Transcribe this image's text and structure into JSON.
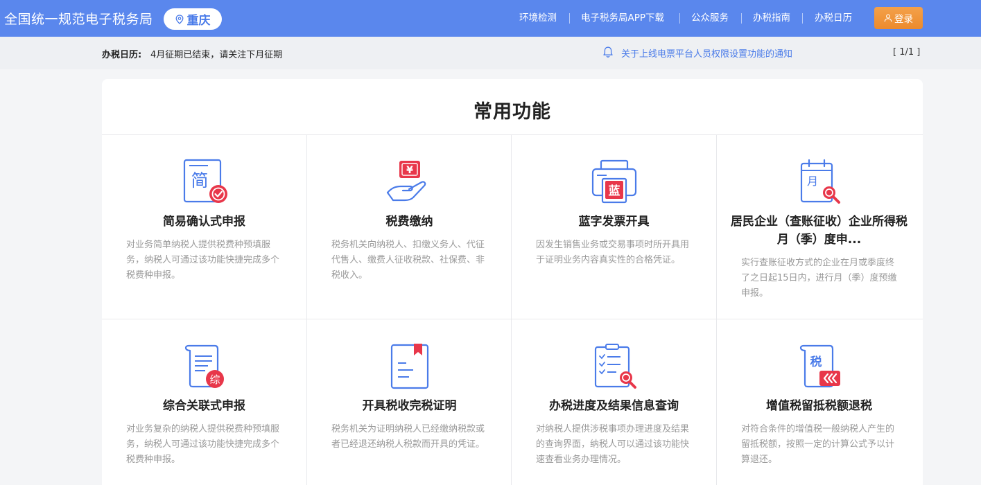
{
  "header": {
    "site_title": "全国统一规范电子税务局",
    "city": "重庆",
    "nav": [
      "环境检测",
      "电子税务局APP下载",
      "公众服务",
      "办税指南",
      "办税日历"
    ],
    "login_label": "登录"
  },
  "notice": {
    "calendar_label": "办税日历:",
    "calendar_text": "4月征期已结束，请关注下月征期",
    "announcement": "关于上线电票平台人员权限设置功能的通知",
    "pager": "[ 1/1 ]"
  },
  "functions": {
    "title": "常用功能",
    "items": [
      {
        "title": "简易确认式申报",
        "desc": "对业务简单纳税人提供税费种预填服务，纳税人可通过该功能快捷完成多个税费种申报。",
        "icon": "simple-declaration-icon",
        "icon_text": "简"
      },
      {
        "title": "税费缴纳",
        "desc": "税务机关向纳税人、扣缴义务人、代征代售人、缴费人征收税款、社保费、非税收入。",
        "icon": "tax-payment-icon",
        "icon_text": "¥"
      },
      {
        "title": "蓝字发票开具",
        "desc": "因发生销售业务或交易事项时所开具用于证明业务内容真实性的合格凭证。",
        "icon": "invoice-printer-icon",
        "icon_text": "蓝"
      },
      {
        "title": "居民企业（查账征收）企业所得税月（季）度申...",
        "desc": "实行查账征收方式的企业在月或季度终了之日起15日内，进行月（季）度预缴申报。",
        "icon": "monthly-calendar-search-icon",
        "icon_text": "月"
      },
      {
        "title": "综合关联式申报",
        "desc": "对业务复杂的纳税人提供税费种预填服务，纳税人可通过该功能快捷完成多个税费种申报。",
        "icon": "comprehensive-declaration-icon",
        "icon_text": "综"
      },
      {
        "title": "开具税收完税证明",
        "desc": "税务机关为证明纳税人已经缴纳税款或者已经退还纳税人税款而开具的凭证。",
        "icon": "tax-certificate-icon",
        "icon_text": ""
      },
      {
        "title": "办税进度及结果信息查询",
        "desc": "对纳税人提供涉税事项办理进度及结果的查询界面，纳税人可以通过该功能快速查看业务办理情况。",
        "icon": "progress-query-icon",
        "icon_text": ""
      },
      {
        "title": "增值税留抵税额退税",
        "desc": "对符合条件的增值税一般纳税人产生的留抵税额，按照一定的计算公式予以计算退还。",
        "icon": "vat-refund-icon",
        "icon_text": "税"
      }
    ]
  },
  "colors": {
    "header_bg": "#5a87ed",
    "accent_blue": "#4a7be9",
    "accent_red": "#e8374a",
    "login_orange": "#ee8c2e"
  }
}
